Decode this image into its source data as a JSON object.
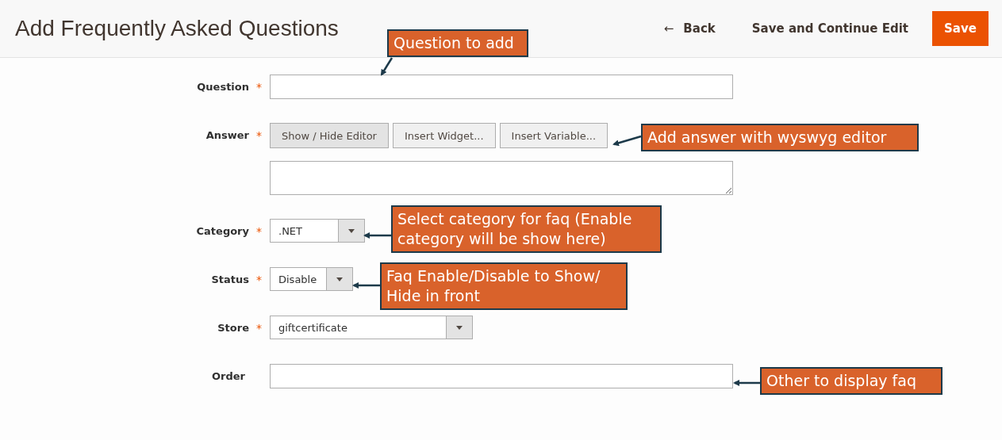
{
  "header": {
    "title": "Add Frequently Asked Questions",
    "back": {
      "icon": "←",
      "label": "Back"
    },
    "save_continue": "Save and Continue Edit",
    "save": "Save"
  },
  "fields": [
    {
      "kind": "text",
      "label": "Question",
      "required_mark": "*"
    },
    {
      "kind": "editor",
      "label": "Answer",
      "required_mark": "*",
      "buttons": [
        {
          "label": "Show / Hide Editor",
          "active": true
        },
        {
          "label": "Insert Widget...",
          "active": false
        },
        {
          "label": "Insert Variable...",
          "active": false
        }
      ]
    },
    {
      "kind": "select",
      "label": "Category",
      "required_mark": "*",
      "value": ".NET"
    },
    {
      "kind": "select",
      "label": "Status",
      "required_mark": "*",
      "value": "Disable"
    },
    {
      "kind": "select",
      "label": "Store",
      "required_mark": "*",
      "value": "giftcertificate"
    },
    {
      "kind": "text",
      "label": "Order"
    }
  ],
  "annotations": [
    {
      "text": "Question to add"
    },
    {
      "text": "Add answer with wyswyg editor"
    },
    {
      "text": "Select category for faq (Enable category will be show here)"
    },
    {
      "text": "Faq Enable/Disable to Show/ Hide in front"
    },
    {
      "text": "Other to display faq"
    }
  ]
}
